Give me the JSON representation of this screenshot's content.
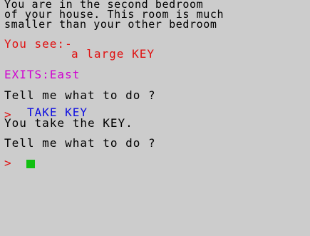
{
  "description": [
    "You are in the second bedroom",
    "of your house. This room is much",
    "smaller than your other bedroom"
  ],
  "you_see_label": "You see:-",
  "item": "a large KEY",
  "exits": "EXITS:East",
  "prompt_question": "Tell me what to do ?",
  "command_prompt": ">",
  "command": "TAKE KEY",
  "response": "You take the KEY.",
  "prompt_question_2": "Tell me what to do ?",
  "input_prompt": ">",
  "colors": {
    "background": "#cccccc",
    "text": "#000000",
    "you_see": "#e01010",
    "exits": "#d000d0",
    "command": "#1010e0",
    "cursor": "#10c010"
  }
}
